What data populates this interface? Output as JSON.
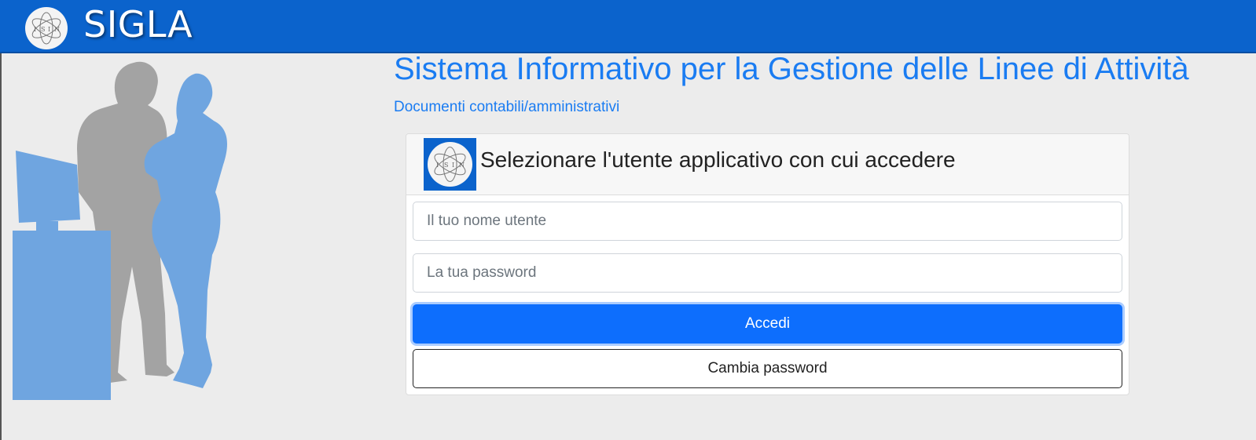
{
  "header": {
    "brand": "SIGLA",
    "logo_icon": "atom-logo-icon",
    "background": "#0b63cc"
  },
  "app": {
    "title": "Sistema Informativo per la Gestione delle Linee di Attività",
    "subtitle": "Documenti contabili/amministrativi",
    "accent": "#1a7cf2"
  },
  "login": {
    "heading": "Selezionare l'utente applicativo con cui accedere",
    "username_placeholder": "Il tuo nome utente",
    "username_value": "",
    "password_placeholder": "La tua password",
    "password_value": "",
    "login_button": "Accedi",
    "change_password_button": "Cambia password",
    "primary_color": "#0d6efd"
  },
  "illustration": {
    "icon": "people-at-computer-illustration"
  }
}
